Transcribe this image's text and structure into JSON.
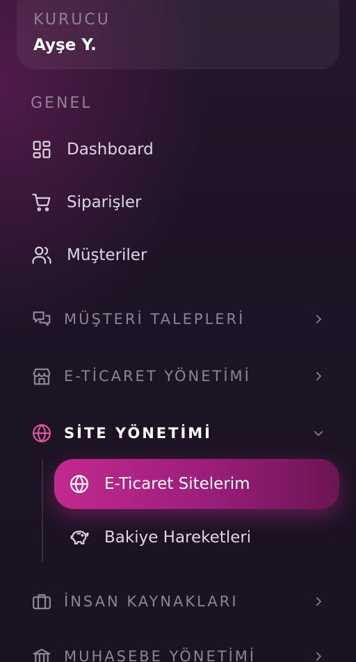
{
  "user": {
    "role": "KURUCU",
    "name": "Ayşe Y."
  },
  "section": {
    "label": "GENEL"
  },
  "nav": {
    "dashboard": "Dashboard",
    "orders": "Siparişler",
    "customers": "Müşteriler"
  },
  "groups": {
    "requests": "MÜŞTERİ TALEPLERİ",
    "ecommerce": "E-TİCARET YÖNETİMİ",
    "site": "SİTE YÖNETİMİ",
    "hr": "İNSAN KAYNAKLARI",
    "accounting": "MUHASEBE YÖNETİMİ"
  },
  "site_subitems": {
    "sites": "E-Ticaret Sitelerim",
    "balance": "Bakiye Hareketleri"
  },
  "colors": {
    "accent": "#c3298f",
    "accent_icon": "#e0559f",
    "muted": "#8d8495",
    "background": "#1d1426"
  },
  "icons": {
    "dashboard": "grid-icon",
    "orders": "cart-icon",
    "customers": "users-icon",
    "requests": "chat-icon",
    "ecommerce": "store-icon",
    "site": "globe-icon",
    "hr": "briefcase-icon",
    "accounting": "bank-icon",
    "balance": "piggy-bank-icon"
  }
}
